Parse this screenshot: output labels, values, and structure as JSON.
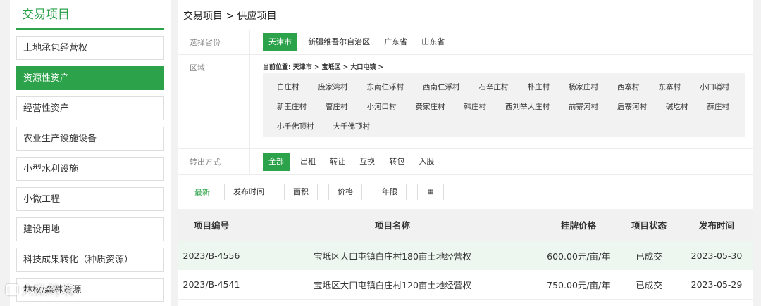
{
  "sidebar": {
    "title": "交易项目",
    "items": [
      {
        "label": "土地承包经营权",
        "active": false
      },
      {
        "label": "资源性资产",
        "active": true
      },
      {
        "label": "经营性资产",
        "active": false
      },
      {
        "label": "农业生产设施设备",
        "active": false
      },
      {
        "label": "小型水利设施",
        "active": false
      },
      {
        "label": "小微工程",
        "active": false
      },
      {
        "label": "建设用地",
        "active": false
      },
      {
        "label": "科技成果转化（种质资源）",
        "active": false
      },
      {
        "label": "林权/森林资源",
        "active": false
      }
    ]
  },
  "breadcrumb": "交易项目 > 供应项目",
  "filters": {
    "province": {
      "label": "选择省份",
      "options": [
        "天津市",
        "新疆维吾尔自治区",
        "广东省",
        "山东省"
      ],
      "selected": "天津市"
    },
    "area": {
      "label": "区域",
      "location": "当前位置:  天津市 > 宝坻区 > 大口屯镇 >",
      "villages": [
        "白庄村",
        "庞家湾村",
        "东南仁浮村",
        "西南仁浮村",
        "石辛庄村",
        "朴庄村",
        "杨家庄村",
        "西寨村",
        "东寨村",
        "小口哨村",
        "新王庄村",
        "曹庄村",
        "小河口村",
        "黄家庄村",
        "韩庄村",
        "西刘举人庄村",
        "前寨河村",
        "后寨河村",
        "碱圪村",
        "薛庄村",
        "小千佛顶村",
        "大千佛顶村"
      ]
    },
    "transfer": {
      "label": "转出方式",
      "options": [
        "全部",
        "出租",
        "转让",
        "互换",
        "转包",
        "入股"
      ],
      "selected": "全部"
    }
  },
  "sort": {
    "latest": "最新",
    "buttons": [
      "发布时间",
      "面积",
      "价格",
      "年限"
    ],
    "grid_icon": "▦"
  },
  "table": {
    "headers": [
      "项目编号",
      "项目名称",
      "挂牌价格",
      "项目状态",
      "发布时间"
    ],
    "rows": [
      {
        "id": "2023/B-4556",
        "name": "宝坻区大口屯镇白庄村180亩土地经营权",
        "price": "600.00元/亩/年",
        "status": "已成交",
        "date": "2023-05-30"
      },
      {
        "id": "2023/B-4541",
        "name": "宝坻区大口屯镇白庄村120亩土地经营权",
        "price": "750.00元/亩/年",
        "status": "已成交",
        "date": "2023-05-29"
      }
    ]
  },
  "watermark": "大数跨境",
  "colors": {
    "accent": "#2ca24a",
    "row_alt": "#eef7ef",
    "village_bg": "#f2f2f2"
  }
}
